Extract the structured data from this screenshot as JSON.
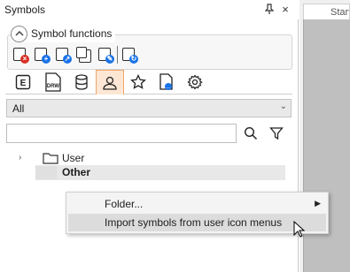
{
  "panel": {
    "title": "Symbols",
    "pin_icon": "pin-icon",
    "close_icon": "close-icon"
  },
  "symbol_functions": {
    "label": "Symbol functions",
    "icons": [
      {
        "name": "delete-symbol-icon",
        "badge_color": "#d93025",
        "badge": "×"
      },
      {
        "name": "new-symbol-icon",
        "badge_color": "#1a73e8",
        "badge": "+"
      },
      {
        "name": "place-symbol-icon",
        "badge_color": "#1a73e8",
        "badge": "↗"
      },
      {
        "name": "copy-symbol-icon",
        "badge_color": "#2b2b2b",
        "badge": ""
      },
      {
        "name": "edit-symbol-icon",
        "badge_color": "#1a73e8",
        "badge": "✎"
      },
      {
        "name": "refresh-symbol-icon",
        "badge_color": "#1a73e8",
        "badge": "↻"
      }
    ]
  },
  "tabs": [
    {
      "name": "tab-electrical",
      "icon": "E"
    },
    {
      "name": "tab-drawing",
      "icon": "DRW"
    },
    {
      "name": "tab-database",
      "icon": "database-icon"
    },
    {
      "name": "tab-user",
      "icon": "user-icon",
      "active": true
    },
    {
      "name": "tab-favorites",
      "icon": "star-icon"
    },
    {
      "name": "tab-document",
      "icon": "document-icon"
    },
    {
      "name": "tab-settings",
      "icon": "gear-icon"
    }
  ],
  "filter": {
    "selected": "All"
  },
  "search": {
    "value": "",
    "placeholder": ""
  },
  "tree": {
    "items": [
      {
        "label": "User",
        "expandable": true
      },
      {
        "label": "Other",
        "selected": true
      }
    ]
  },
  "document_tab": {
    "label": "Start"
  },
  "context_menu": {
    "items": [
      {
        "label": "Folder...",
        "submenu": true
      },
      {
        "label": "Import symbols from user icon menus",
        "highlighted": true
      }
    ]
  },
  "colors": {
    "accent_tab": "#fde7d4",
    "accent_tab_border": "#f0a86a",
    "menu_highlight": "#dcdcdc"
  }
}
